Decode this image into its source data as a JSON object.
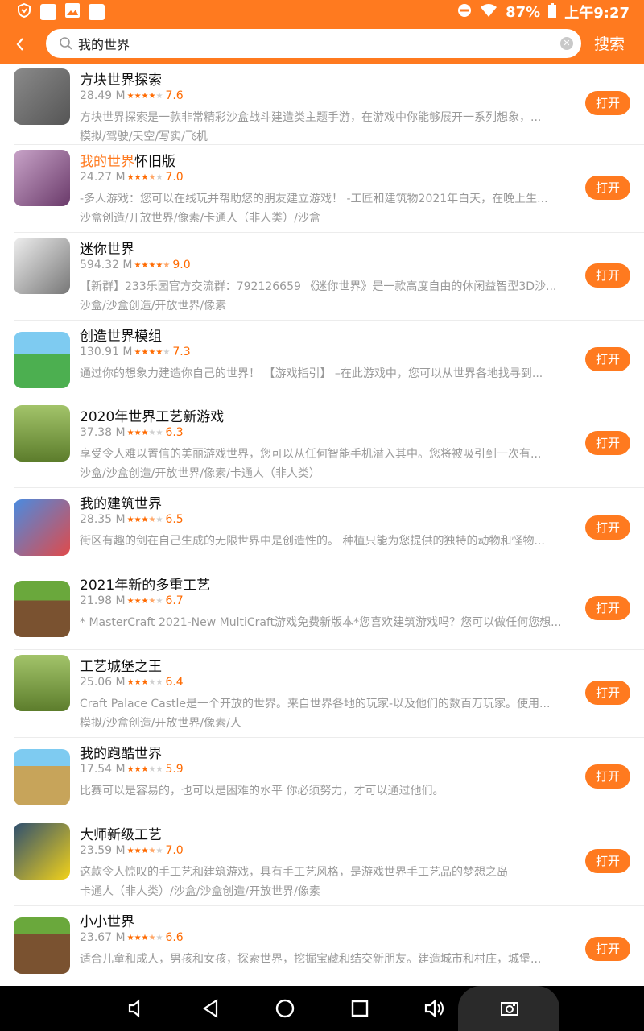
{
  "status": {
    "battery": "87%",
    "time": "上午9:27"
  },
  "search": {
    "query": "我的世界",
    "button": "搜索"
  },
  "apps": [
    {
      "name_prefix": "",
      "name_highlight": "",
      "name": "方块世界探索",
      "size": "28.49 M",
      "stars": 4,
      "score": "7.6",
      "desc": "方块世界探索是一款非常精彩沙盒战斗建造类主题手游，在游戏中你能够展开一系列想象，...",
      "tags": "模拟/驾驶/天空/写实/飞机",
      "action": "打开"
    },
    {
      "name_prefix": "",
      "name_highlight": "我的世界",
      "name": "怀旧版",
      "size": "24.27 M",
      "stars": 3.5,
      "score": "7.0",
      "desc": "-多人游戏：您可以在线玩并帮助您的朋友建立游戏！ -工匠和建筑物2021年白天，在晚上生...",
      "tags": "沙盒创造/开放世界/像素/卡通人（非人类）/沙盒",
      "action": "打开"
    },
    {
      "name_prefix": "",
      "name_highlight": "",
      "name": "迷你世界",
      "size": "594.32 M",
      "stars": 4.5,
      "score": "9.0",
      "desc": "【新群】233乐园官方交流群：792126659 《迷你世界》是一款高度自由的休闲益智型3D沙...",
      "tags": "沙盒/沙盒创造/开放世界/像素",
      "action": "打开"
    },
    {
      "name_prefix": "",
      "name_highlight": "",
      "name": "创造世界模组",
      "size": "130.91 M",
      "stars": 4,
      "score": "7.3",
      "desc": "通过你的想象力建造你自己的世界！ 【游戏指引】 –在此游戏中，您可以从世界各地找寻到...",
      "tags": "",
      "action": "打开"
    },
    {
      "name_prefix": "",
      "name_highlight": "",
      "name": "2020年世界工艺新游戏",
      "size": "37.38 M",
      "stars": 3,
      "score": "6.3",
      "desc": "享受令人难以置信的美丽游戏世界，您可以从任何智能手机潜入其中。您将被吸引到一次有...",
      "tags": "沙盒/沙盒创造/开放世界/像素/卡通人（非人类）",
      "action": "打开"
    },
    {
      "name_prefix": "",
      "name_highlight": "",
      "name": "我的建筑世界",
      "size": "28.35 M",
      "stars": 3.5,
      "score": "6.5",
      "desc": "街区有趣的剑在自己生成的无限世界中是创造性的。 种植只能为您提供的独特的动物和怪物...",
      "tags": "",
      "action": "打开"
    },
    {
      "name_prefix": "",
      "name_highlight": "",
      "name": "2021年新的多重工艺",
      "size": "21.98 M",
      "stars": 3.5,
      "score": "6.7",
      "desc": "* MasterCraft 2021-New MultiCraft游戏免费新版本*您喜欢建筑游戏吗？您可以做任何您想...",
      "tags": "",
      "action": "打开"
    },
    {
      "name_prefix": "",
      "name_highlight": "",
      "name": "工艺城堡之王",
      "size": "25.06 M",
      "stars": 3,
      "score": "6.4",
      "desc": "Craft Palace Castle是一个开放的世界。来自世界各地的玩家-以及他们的数百万玩家。使用...",
      "tags": "模拟/沙盒创造/开放世界/像素/人",
      "action": "打开"
    },
    {
      "name_prefix": "",
      "name_highlight": "",
      "name": "我的跑酷世界",
      "size": "17.54 M",
      "stars": 3,
      "score": "5.9",
      "desc": "比赛可以是容易的，也可以是困难的水平 你必须努力，才可以通过他们。",
      "tags": "",
      "action": "打开"
    },
    {
      "name_prefix": "",
      "name_highlight": "",
      "name": "大师新级工艺",
      "size": "23.59 M",
      "stars": 3.5,
      "score": "7.0",
      "desc": "这款令人惊叹的手工艺和建筑游戏，具有手工艺风格，是游戏世界手工艺品的梦想之岛",
      "tags": "卡通人（非人类）/沙盒/沙盒创造/开放世界/像素",
      "action": "打开"
    },
    {
      "name_prefix": "",
      "name_highlight": "",
      "name": "小小世界",
      "size": "23.67 M",
      "stars": 3.5,
      "score": "6.6",
      "desc": "适合儿童和成人，男孩和女孩，探索世界，挖掘宝藏和结交新朋友。建造城市和村庄，城堡...",
      "tags": "",
      "action": "打开"
    }
  ]
}
